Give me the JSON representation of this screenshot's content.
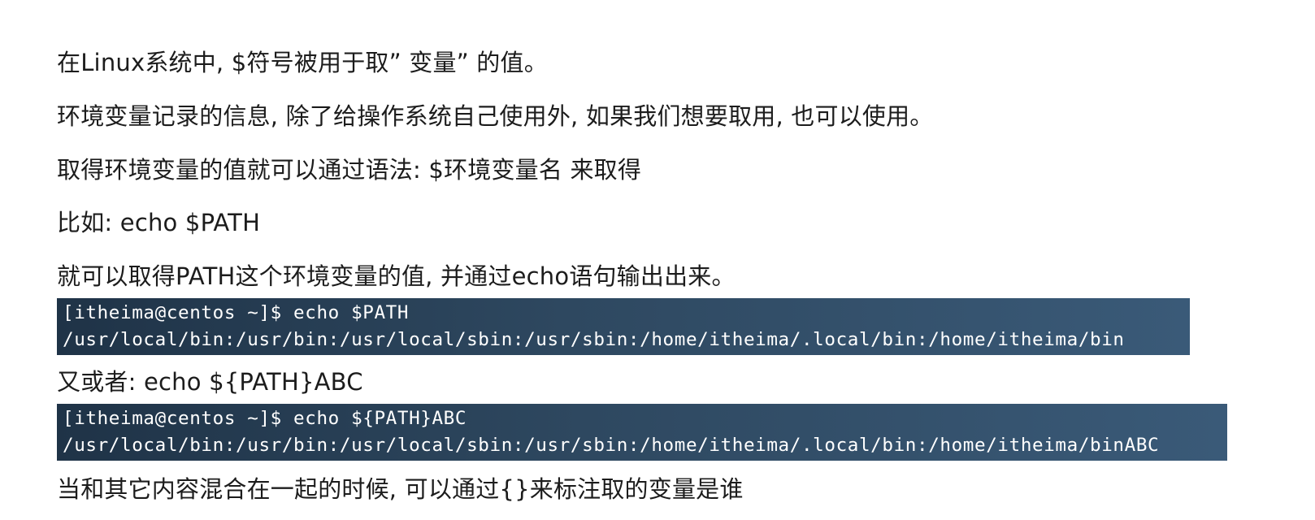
{
  "paragraphs": {
    "p1": "在Linux系统中, $符号被用于取” 变量” 的值。",
    "p2": "环境变量记录的信息, 除了给操作系统自己使用外, 如果我们想要取用, 也可以使用。",
    "p3": "取得环境变量的值就可以通过语法: $环境变量名  来取得",
    "p4": "比如:  echo $PATH",
    "p5": "就可以取得PATH这个环境变量的值, 并通过echo语句输出出来。",
    "p6": "又或者: echo ${PATH}ABC",
    "p7": "当和其它内容混合在一起的时候, 可以通过{}来标注取的变量是谁"
  },
  "terminal1": {
    "command": "[itheima@centos ~]$ echo $PATH",
    "output": "/usr/local/bin:/usr/bin:/usr/local/sbin:/usr/sbin:/home/itheima/.local/bin:/home/itheima/bin"
  },
  "terminal2": {
    "command": "[itheima@centos ~]$ echo ${PATH}ABC",
    "output": "/usr/local/bin:/usr/bin:/usr/local/sbin:/usr/sbin:/home/itheima/.local/bin:/home/itheima/binABC"
  },
  "colors": {
    "text": "#1c1c1c",
    "terminal_bg_left": "#1f3347",
    "terminal_bg_right": "#3a5a78",
    "terminal_text": "#ffffff"
  }
}
